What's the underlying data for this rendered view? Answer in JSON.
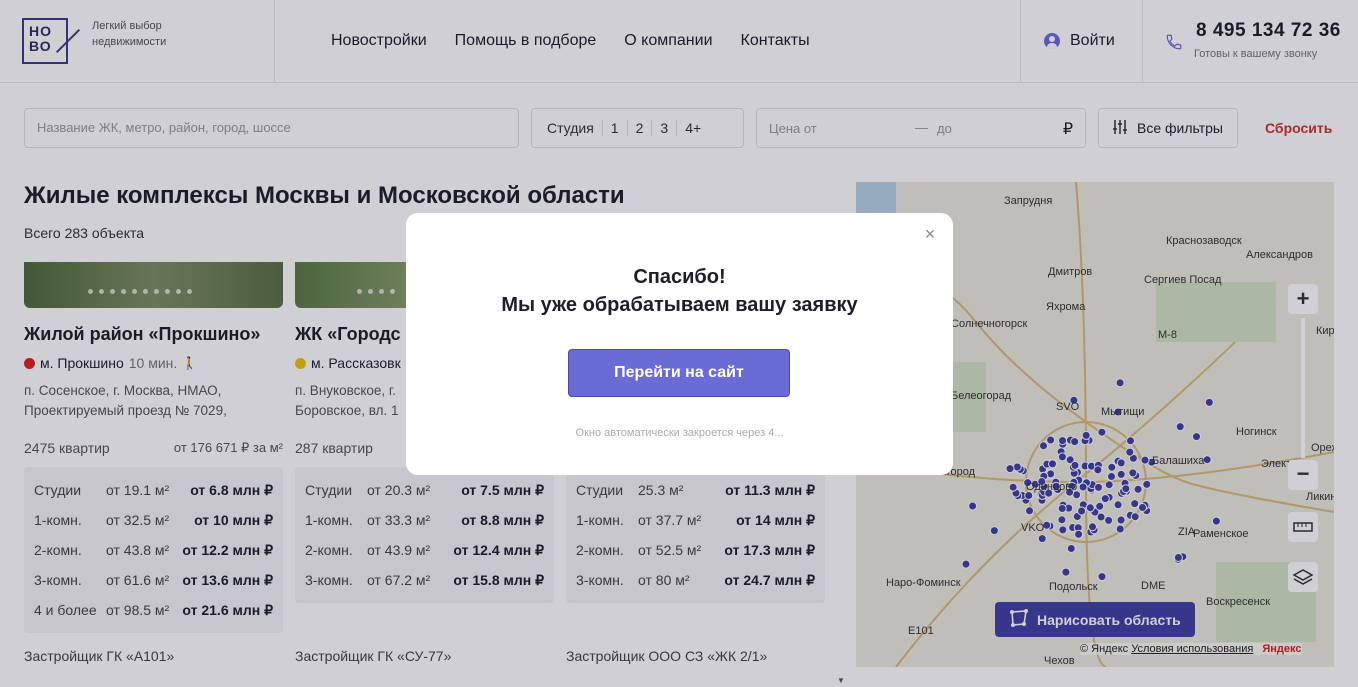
{
  "header": {
    "logo_text": "НО\nВО",
    "tagline": "Легкий выбор недвижимости",
    "nav": [
      "Новостройки",
      "Помощь в подборе",
      "О компании",
      "Контакты"
    ],
    "login": "Войти",
    "phone": "8 495 134 72 36",
    "phone_sub": "Готовы к вашему звонку"
  },
  "filters": {
    "search_placeholder": "Название ЖК, метро, район, город, шоссе",
    "rooms": [
      "Студия",
      "1",
      "2",
      "3",
      "4+"
    ],
    "price_from": "Цена от",
    "price_dash": "—",
    "price_to": "до",
    "currency": "₽",
    "all_filters": "Все фильтры",
    "reset": "Сбросить"
  },
  "page": {
    "title": "Жилые комплексы Москвы и Московской области",
    "count": "Всего 283 объекта"
  },
  "cards": [
    {
      "name": "Жилой район «Прокшино»",
      "metro": "м. Прокшино",
      "metro_color": "#e02020",
      "walk": "10 мин.",
      "address": "п. Сосенское, г. Москва, НМАО, Проектируемый проезд № 7029,",
      "flats": "2475 квартир",
      "ppm": "от 176 671 ₽ за м²",
      "rows": [
        {
          "t": "Студии",
          "a": "от 19.1 м²",
          "p": "от 6.8 млн ₽"
        },
        {
          "t": "1-комн.",
          "a": "от 32.5 м²",
          "p": "от 10 млн ₽"
        },
        {
          "t": "2-комн.",
          "a": "от 43.8 м²",
          "p": "от 12.2 млн ₽"
        },
        {
          "t": "3-комн.",
          "a": "от 61.6 м²",
          "p": "от 13.6 млн ₽"
        },
        {
          "t": "4 и более",
          "a": "от 98.5 м²",
          "p": "от 21.6 млн ₽"
        }
      ],
      "developer": "Застройщик ГК «А101»"
    },
    {
      "name": "ЖК «Городс",
      "metro": "м. Рассказовк",
      "metro_color": "#f2c200",
      "walk": "",
      "address": "п. Внуковское, г. Боровское, вл. 1",
      "flats": "287 квартир",
      "ppm": "",
      "rows": [
        {
          "t": "Студии",
          "a": "от 20.3 м²",
          "p": "от 7.5 млн ₽"
        },
        {
          "t": "1-комн.",
          "a": "от 33.3 м²",
          "p": "от 8.8 млн ₽"
        },
        {
          "t": "2-комн.",
          "a": "от 43.9 м²",
          "p": "от 12.4 млн ₽"
        },
        {
          "t": "3-комн.",
          "a": "от 67.2 м²",
          "p": "от 15.8 млн ₽"
        }
      ],
      "developer": "Застройщик ГК «СУ-77»"
    },
    {
      "rows": [
        {
          "t": "Студии",
          "a": "25.3 м²",
          "p": "от 11.3 млн ₽"
        },
        {
          "t": "1-комн.",
          "a": "от 37.7 м²",
          "p": "от 14 млн ₽"
        },
        {
          "t": "2-комн.",
          "a": "от 52.5 м²",
          "p": "от 17.3 млн ₽"
        },
        {
          "t": "3-комн.",
          "a": "от 80 м²",
          "p": "от 24.7 млн ₽"
        }
      ],
      "developer": "Застройщик ООО СЗ «ЖК 2/1»"
    }
  ],
  "map": {
    "draw_area": "Нарисовать область",
    "copyright": "© Яндекс",
    "terms": "Условия использования",
    "brand": "Яндекс",
    "labels": [
      "Запрудня",
      "Краснозаводск",
      "Дмитров",
      "Сергиев Посад",
      "Александров",
      "Яхрома",
      "Киржач",
      "Мытищи",
      "Ногинск",
      "Балашиха",
      "Орехово",
      "Электро",
      "Ликино",
      "Раменское",
      "Наро-Фоминск",
      "Подольск",
      "Воскресенск",
      "Чехов",
      "Одинцово",
      "Звенигород",
      "Солнечногорск",
      "Белеогорад",
      "SVO",
      "VKO",
      "DME",
      "ZIA",
      "E101",
      "М-8"
    ]
  },
  "modal": {
    "title_line1": "Спасибо!",
    "title_line2": "Мы уже обрабатываем вашу заявку",
    "button": "Перейти на сайт",
    "note": "Окно автоматически закроется через 4..."
  }
}
